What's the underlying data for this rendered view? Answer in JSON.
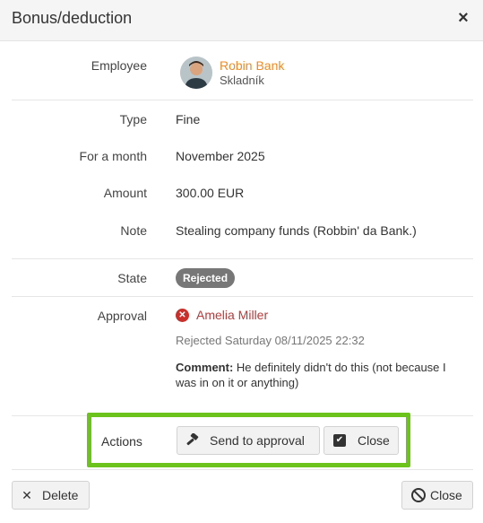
{
  "dialog": {
    "title": "Bonus/deduction",
    "close_glyph": "×"
  },
  "fields": {
    "employee_label": "Employee",
    "employee_name": "Robin Bank",
    "employee_role": "Skladník",
    "type_label": "Type",
    "type_value": "Fine",
    "month_label": "For a month",
    "month_value": "November 2025",
    "amount_label": "Amount",
    "amount_value": "300.00 EUR",
    "note_label": "Note",
    "note_value": "Stealing company funds (Robbin' da Bank.)",
    "state_label": "State",
    "state_value": "Rejected",
    "approval_label": "Approval",
    "approver_name": "Amelia Miller",
    "rejected_at": "Rejected Saturday 08/11/2025 22:32",
    "comment_label": "Comment:",
    "comment_text": " He definitely didn't do this (not because I was in on it or anything)"
  },
  "actions": {
    "label": "Actions",
    "send_to_approval": "Send to approval",
    "close": "Close"
  },
  "footer": {
    "delete": "Delete",
    "close": "Close"
  },
  "icons": {
    "dialog_close": "close-icon",
    "send": "gavel-icon",
    "close_action": "checkbox-icon",
    "delete": "times-icon",
    "close_footer": "ban-icon",
    "approval_status": "reject-circle-icon"
  },
  "colors": {
    "employee_link": "#f08a24",
    "approver_link": "#b83b3b",
    "reject_icon": "#c9302c",
    "state_badge": "#777777",
    "highlight_border": "#6cc31c",
    "header_bg": "#f5f5f5"
  }
}
